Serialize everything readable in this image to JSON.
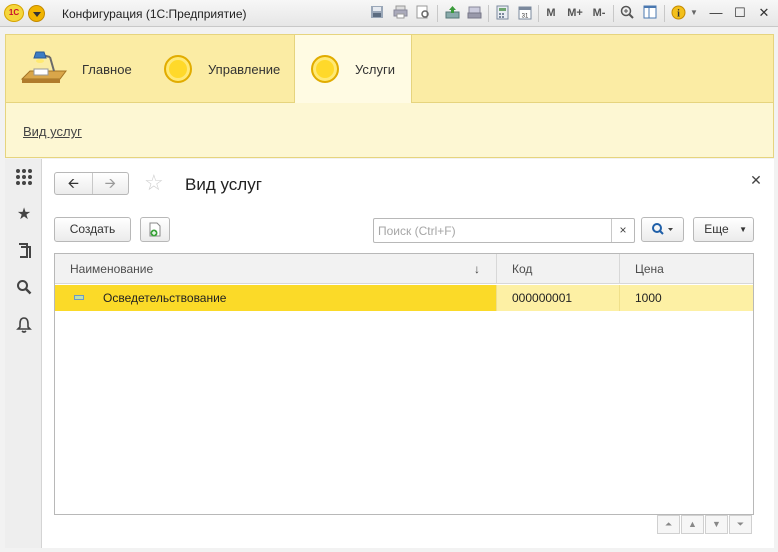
{
  "app": {
    "title": "Конфигурация  (1С:Предприятие)",
    "logo_text": "1С"
  },
  "toolbar": {
    "m_label": "M",
    "m_plus_label": "M+",
    "m_minus_label": "M-"
  },
  "sections": [
    {
      "label": "Главное"
    },
    {
      "label": "Управление"
    },
    {
      "label": "Услуги"
    }
  ],
  "functions": {
    "link": "Вид услуг"
  },
  "form": {
    "title": "Вид услуг",
    "create_label": "Создать",
    "more_label": "Еще",
    "search_placeholder": "Поиск (Ctrl+F)",
    "columns": [
      "Наименование",
      "Код",
      "Цена"
    ],
    "rows": [
      {
        "name": "Осведетельствование",
        "code": "000000001",
        "price": "1000"
      }
    ]
  },
  "colors": {
    "accent_yellow": "#fbda28",
    "sections_bg": "#fbeca4",
    "selected_row_rest": "#fdf0a4"
  }
}
